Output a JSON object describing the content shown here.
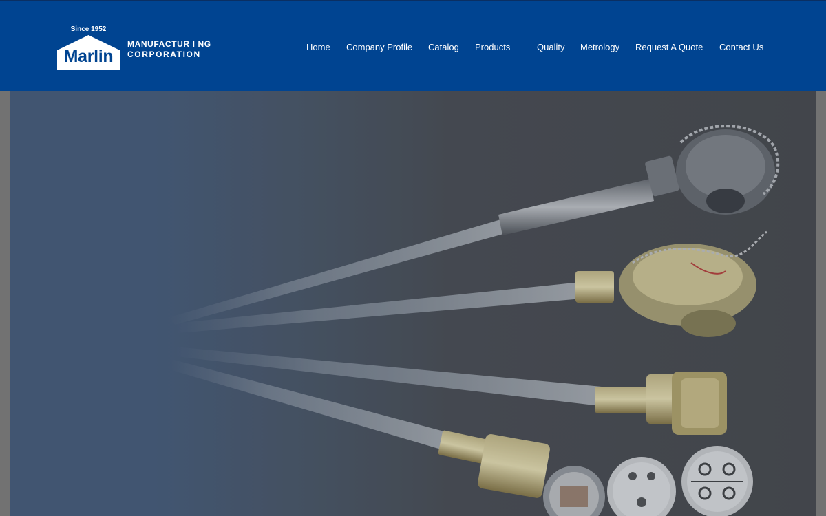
{
  "brand": {
    "since": "Since 1952",
    "name": "Marlin",
    "tagline_line1": "MANUFACTUR I NG",
    "tagline_line2": "CORPORATION",
    "primary_color": "#004491"
  },
  "nav": {
    "items": [
      {
        "label": "Home"
      },
      {
        "label": "Company Profile"
      },
      {
        "label": "Catalog"
      },
      {
        "label": "Products"
      },
      {
        "label": "Quality"
      },
      {
        "label": "Metrology"
      },
      {
        "label": "Request A Quote"
      },
      {
        "label": "Contact Us"
      }
    ]
  },
  "hero": {
    "image_subject": "thermocouple-assemblies-photo"
  }
}
